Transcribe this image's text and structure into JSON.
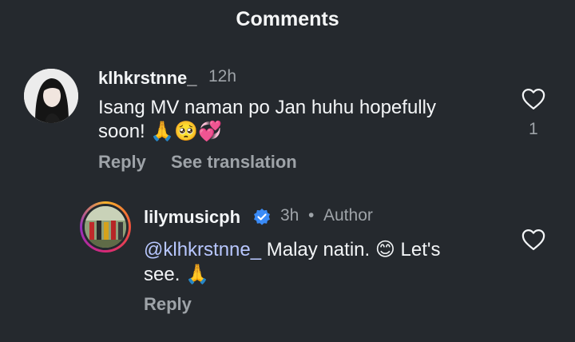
{
  "header": {
    "title": "Comments"
  },
  "comment": {
    "username": "klhkrstnne_",
    "time": "12h",
    "text_line1": "Isang MV naman po Jan huhu hopefully",
    "text_line2": "soon! 🙏🥺💞",
    "reply_label": "Reply",
    "translate_label": "See translation",
    "like_count": "1"
  },
  "reply": {
    "username": "lilymusicph",
    "verified": true,
    "time": "3h",
    "separator": "•",
    "role": "Author",
    "mention": "@klhkrstnne_",
    "text_line1_rest": " Malay natin. 😊 Let's",
    "text_line2": "see. 🙏",
    "reply_label": "Reply"
  },
  "colors": {
    "background": "#25292e",
    "primary_text": "#f3f5f7",
    "secondary_text": "#9ea3a8",
    "mention": "#b8c7ff",
    "verified_badge": "#3a8bf7"
  },
  "icons": [
    "heart-icon",
    "verified-badge-icon",
    "threads-at-icon"
  ]
}
